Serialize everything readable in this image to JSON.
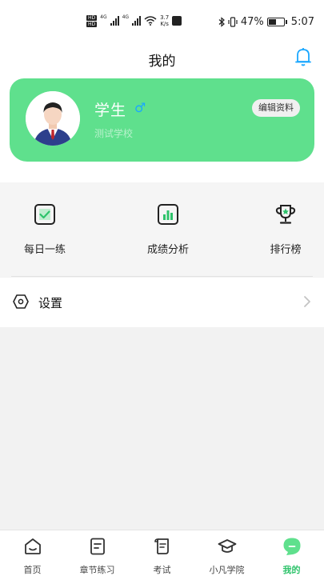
{
  "status_bar": {
    "hd_top": "HD",
    "hd_bottom": "HD",
    "net_left": "4G",
    "net_right": "4G",
    "speed_value": "3.7",
    "speed_unit": "K/s",
    "battery": "47%",
    "battery_level": 0.47,
    "time": "5:07"
  },
  "header": {
    "title": "我的",
    "icon": "bell-icon"
  },
  "profile": {
    "name": "学生",
    "gender_symbol": "♂",
    "school": "测试学校",
    "edit_label": "编辑资料"
  },
  "quick_actions": [
    {
      "label": "每日一练",
      "icon": "checkbox-icon"
    },
    {
      "label": "成绩分析",
      "icon": "bar-chart-icon"
    },
    {
      "label": "排行榜",
      "icon": "trophy-icon"
    }
  ],
  "settings": {
    "label": "设置",
    "icon": "hexagon-settings-icon"
  },
  "tabs": [
    {
      "label": "首页",
      "icon": "home-icon"
    },
    {
      "label": "章节练习",
      "icon": "document-icon"
    },
    {
      "label": "考试",
      "icon": "scroll-icon"
    },
    {
      "label": "小凡学院",
      "icon": "graduation-cap-icon"
    },
    {
      "label": "我的",
      "icon": "profile-bubble-icon",
      "active": true
    }
  ],
  "colors": {
    "accent": "#5fe08d",
    "active_tab": "#2ec36b",
    "gender": "#1aa7ff",
    "bell": "#1aa7ff"
  }
}
